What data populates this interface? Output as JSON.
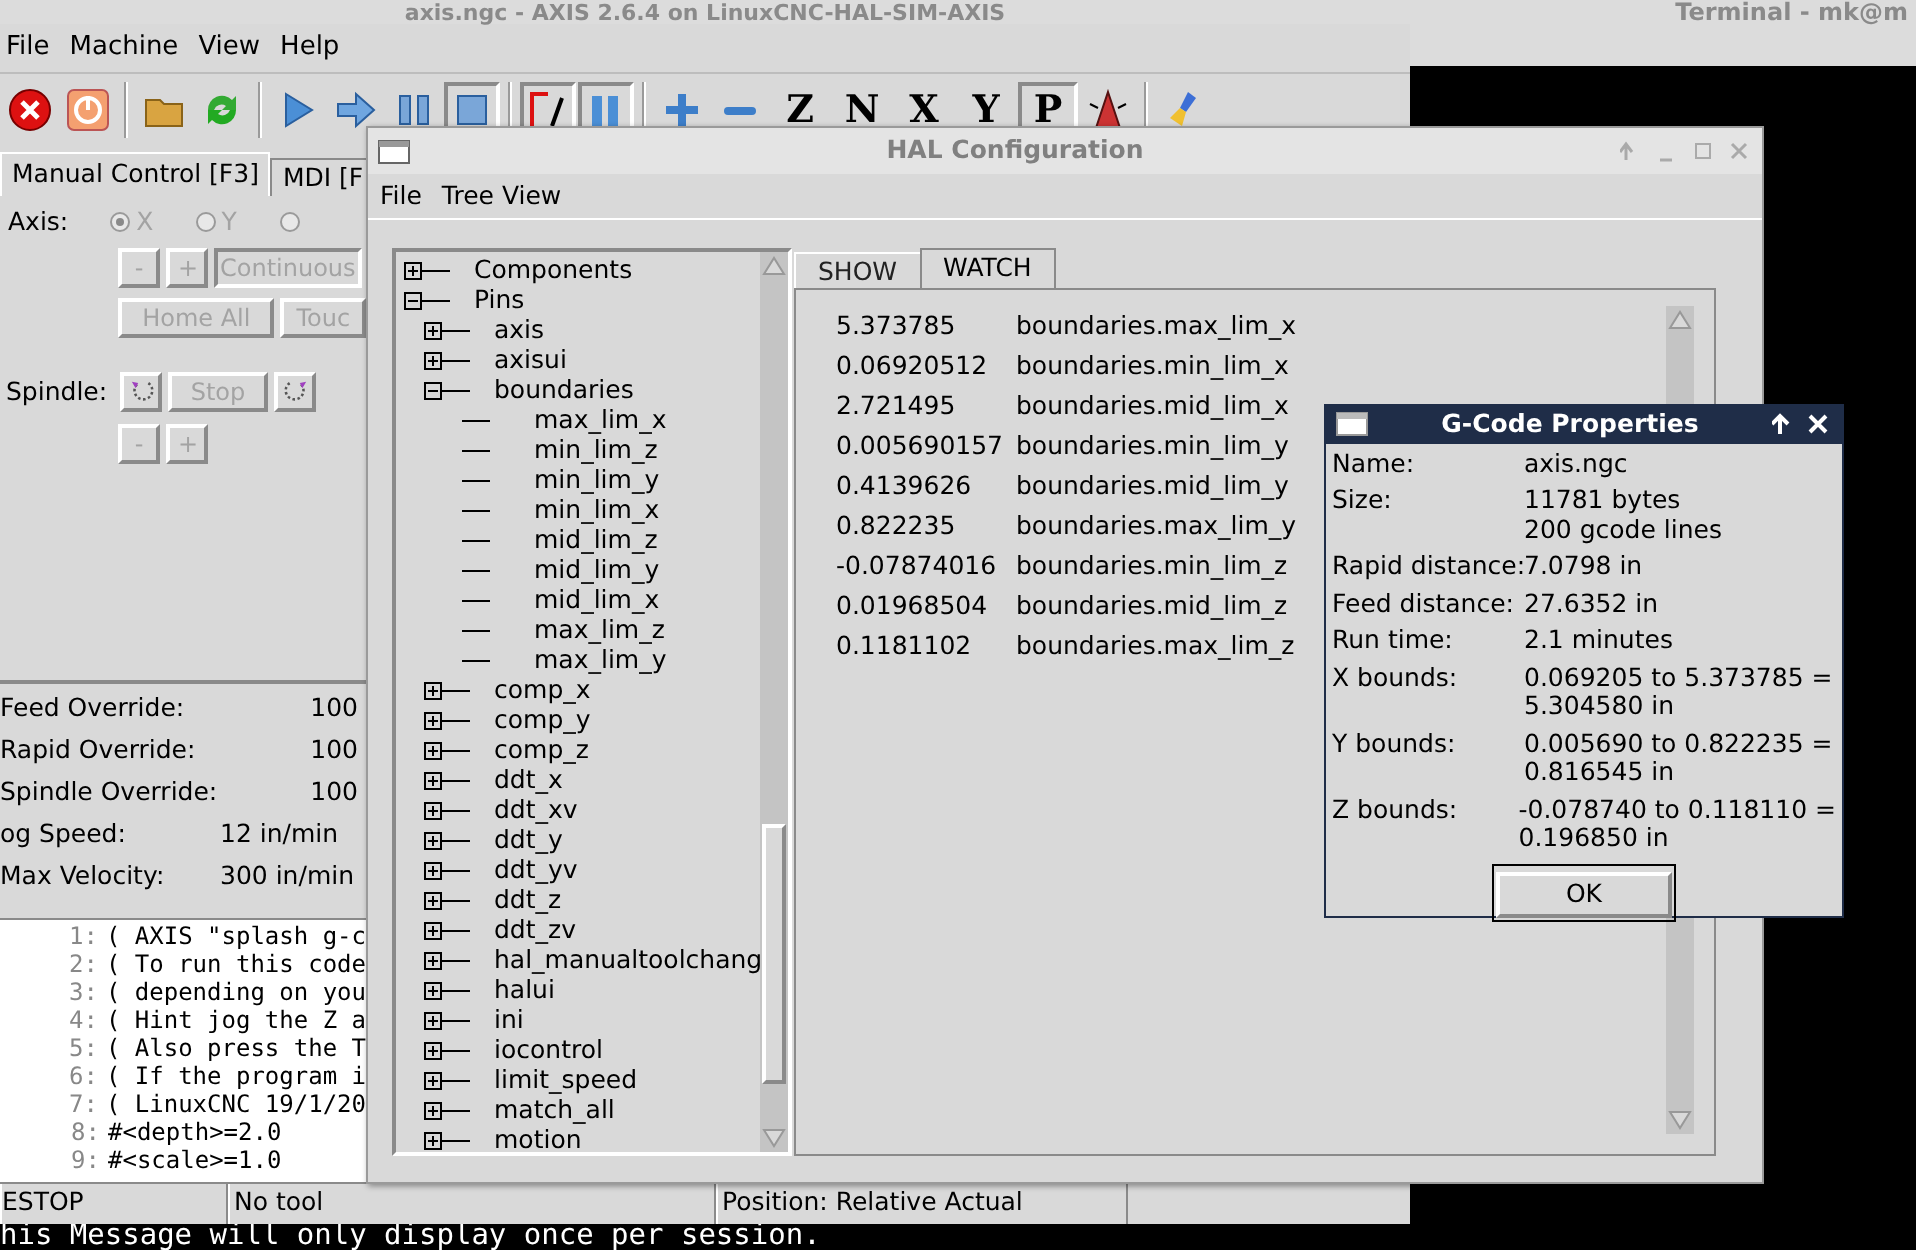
{
  "terminal": {
    "title": "Terminal - mk@m",
    "message": "his Message will only display once per session."
  },
  "axis_window": {
    "title": "axis.ngc - AXIS 2.6.4 on LinuxCNC-HAL-SIM-AXIS",
    "menu": [
      "File",
      "Machine",
      "View",
      "Help"
    ],
    "view_buttons": [
      {
        "label": "Z",
        "selected": false
      },
      {
        "label": "N",
        "selected": false
      },
      {
        "label": "X",
        "selected": false
      },
      {
        "label": "Y",
        "selected": false
      },
      {
        "label": "P",
        "selected": true
      }
    ],
    "tabs": [
      {
        "label": "Manual Control [F3]",
        "selected": true
      },
      {
        "label": "MDI [F",
        "selected": false
      }
    ],
    "axis_label": "Axis:",
    "axes": [
      {
        "label": "X",
        "selected": true
      },
      {
        "label": "Y",
        "selected": false
      },
      {
        "selected": false
      }
    ],
    "jog": {
      "disabled": true,
      "minus": "-",
      "plus": "+",
      "increment": "Continuous",
      "home": "Home All",
      "touch": "Touc"
    },
    "spindle": {
      "disabled": true,
      "label": "Spindle:",
      "stop": "Stop",
      "minus": "-",
      "plus": "+"
    },
    "overrides": [
      {
        "label": "Feed Override:",
        "value": "100"
      },
      {
        "label": "Rapid Override:",
        "value": "100"
      },
      {
        "label": "Spindle Override:",
        "value": "100"
      },
      {
        "label": "og Speed:",
        "value": "12 in/min"
      },
      {
        "label": "Max Velocity:",
        "value": "300 in/min"
      }
    ],
    "gcode": [
      {
        "number": "1:",
        "text": "( AXIS \"splash g-c"
      },
      {
        "number": "2:",
        "text": "( To run this code"
      },
      {
        "number": "3:",
        "text": "( depending on you"
      },
      {
        "number": "4:",
        "text": "( Hint jog the Z a"
      },
      {
        "number": "5:",
        "text": "( Also press the T"
      },
      {
        "number": "6:",
        "text": "( If the program i"
      },
      {
        "number": "7:",
        "text": "( LinuxCNC 19/1/20"
      },
      {
        "number": "8:",
        "text": "#<depth>=2.0"
      },
      {
        "number": "9:",
        "text": "#<scale>=1.0"
      }
    ],
    "status_bar": [
      "ESTOP",
      "No tool",
      "Position: Relative Actual"
    ]
  },
  "hal_window": {
    "title": "HAL Configuration",
    "menu": [
      "File",
      "Tree View"
    ],
    "tree": [
      {
        "label": "Components",
        "expanded": false
      },
      {
        "label": "Pins",
        "expanded": true,
        "children": [
          {
            "label": "axis",
            "expanded": false
          },
          {
            "label": "axisui",
            "expanded": false
          },
          {
            "label": "boundaries",
            "expanded": true,
            "children": [
              {
                "label": "max_lim_x"
              },
              {
                "label": "min_lim_z"
              },
              {
                "label": "min_lim_y"
              },
              {
                "label": "min_lim_x"
              },
              {
                "label": "mid_lim_z"
              },
              {
                "label": "mid_lim_y"
              },
              {
                "label": "mid_lim_x"
              },
              {
                "label": "max_lim_z"
              },
              {
                "label": "max_lim_y"
              }
            ]
          },
          {
            "label": "comp_x",
            "expanded": false
          },
          {
            "label": "comp_y",
            "expanded": false
          },
          {
            "label": "comp_z",
            "expanded": false
          },
          {
            "label": "ddt_x",
            "expanded": false
          },
          {
            "label": "ddt_xv",
            "expanded": false
          },
          {
            "label": "ddt_y",
            "expanded": false
          },
          {
            "label": "ddt_yv",
            "expanded": false
          },
          {
            "label": "ddt_z",
            "expanded": false
          },
          {
            "label": "ddt_zv",
            "expanded": false
          },
          {
            "label": "hal_manualtoolchang",
            "expanded": false
          },
          {
            "label": "halui",
            "expanded": false
          },
          {
            "label": "ini",
            "expanded": false
          },
          {
            "label": "iocontrol",
            "expanded": false
          },
          {
            "label": "limit_speed",
            "expanded": false
          },
          {
            "label": "match_all",
            "expanded": false
          },
          {
            "label": "motion",
            "expanded": false
          }
        ]
      }
    ],
    "tabs": [
      {
        "label": "SHOW",
        "selected": false
      },
      {
        "label": "WATCH",
        "selected": true
      }
    ],
    "watch": [
      {
        "value": "5.373785",
        "pin": "boundaries.max_lim_x"
      },
      {
        "value": "0.06920512",
        "pin": "boundaries.min_lim_x"
      },
      {
        "value": "2.721495",
        "pin": "boundaries.mid_lim_x"
      },
      {
        "value": "0.005690157",
        "pin": "boundaries.min_lim_y"
      },
      {
        "value": "0.4139626",
        "pin": "boundaries.mid_lim_y"
      },
      {
        "value": "0.822235",
        "pin": "boundaries.max_lim_y"
      },
      {
        "value": "-0.07874016",
        "pin": "boundaries.min_lim_z"
      },
      {
        "value": "0.01968504",
        "pin": "boundaries.mid_lim_z"
      },
      {
        "value": "0.1181102",
        "pin": "boundaries.max_lim_z"
      }
    ]
  },
  "gcode_properties": {
    "title": "G-Code Properties",
    "rows": [
      {
        "label": "Name:",
        "lines": [
          "axis.ngc"
        ]
      },
      {
        "label": "Size:",
        "lines": [
          "11781 bytes",
          "200 gcode lines"
        ]
      },
      {
        "label": "Rapid distance:",
        "lines": [
          "7.0798 in"
        ]
      },
      {
        "label": "Feed distance:",
        "lines": [
          "27.6352 in"
        ]
      },
      {
        "label": "Run time:",
        "lines": [
          "2.1 minutes"
        ]
      },
      {
        "label": "X bounds:",
        "lines": [
          "0.069205 to 5.373785 =",
          "5.304580 in"
        ]
      },
      {
        "label": "Y bounds:",
        "lines": [
          "0.005690 to 0.822235 =",
          "0.816545 in"
        ]
      },
      {
        "label": "Z bounds:",
        "lines": [
          "-0.078740 to 0.118110 =",
          "0.196850 in"
        ]
      }
    ],
    "ok": "OK"
  }
}
